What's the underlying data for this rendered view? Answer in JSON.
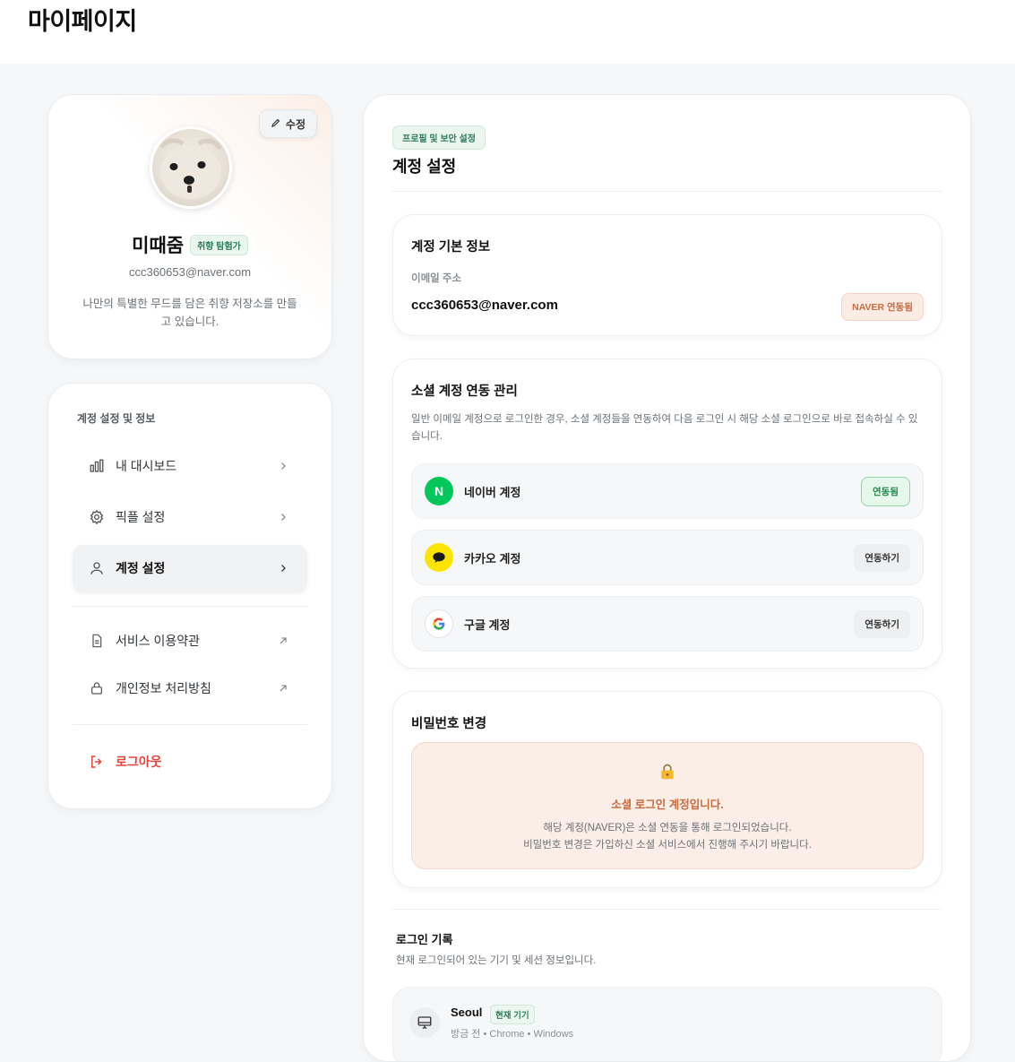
{
  "page": {
    "title": "마이페이지"
  },
  "profile": {
    "edit_label": "수정",
    "name": "미때줌",
    "tag": "취향 탐험가",
    "email": "ccc360653@naver.com",
    "bio": "나만의 특별한 무드를 담은 취향 저장소를 만들고 있습니다."
  },
  "menu": {
    "title": "계정 설정 및 정보",
    "items": [
      {
        "label": "내 대시보드",
        "icon": "bar-chart-icon"
      },
      {
        "label": "픽플 설정",
        "icon": "gear-icon"
      },
      {
        "label": "계정 설정",
        "icon": "user-icon"
      }
    ],
    "links": [
      {
        "label": "서비스 이용약관",
        "icon": "document-icon"
      },
      {
        "label": "개인정보 처리방침",
        "icon": "lock-icon"
      }
    ],
    "logout": "로그아웃"
  },
  "main": {
    "breadcrumb": "프로필 및 보안 설정",
    "title": "계정 설정",
    "basic": {
      "title": "계정 기본 정보",
      "email_label": "이메일 주소",
      "email": "ccc360653@naver.com",
      "badge": "NAVER 연동됨"
    },
    "social": {
      "title": "소셜 계정 연동 관리",
      "desc": "일반 이메일 계정으로 로그인한 경우, 소셜 계정들을 연동하여 다음 로그인 시 해당 소셜 로그인으로 바로 접속하실 수 있습니다.",
      "accounts": [
        {
          "label": "네이버 계정",
          "logo": "N",
          "action": "연동됨",
          "color": "#03c75a"
        },
        {
          "label": "카카오 계정",
          "logo": "kakao-icon",
          "action": "연동하기",
          "color": "#fee500"
        },
        {
          "label": "구글 계정",
          "logo": "G",
          "action": "연동하기",
          "color": "#4285f4"
        }
      ]
    },
    "password": {
      "title": "비밀번호 변경",
      "notice_title": "소셜 로그인 계정입니다.",
      "notice_line1": "해당 계정(NAVER)은 소셜 연동을 통해 로그인되었습니다.",
      "notice_line2": "비밀번호 변경은 가입하신 소셜 서비스에서 진행해 주시기 바랍니다."
    },
    "login_log": {
      "title": "로그인 기록",
      "desc": "현재 로그인되어 있는 기기 및 세션 정보입니다.",
      "device": {
        "city": "Seoul",
        "badge": "현재 기기",
        "meta": "방금 전 • Chrome • Windows"
      }
    }
  }
}
